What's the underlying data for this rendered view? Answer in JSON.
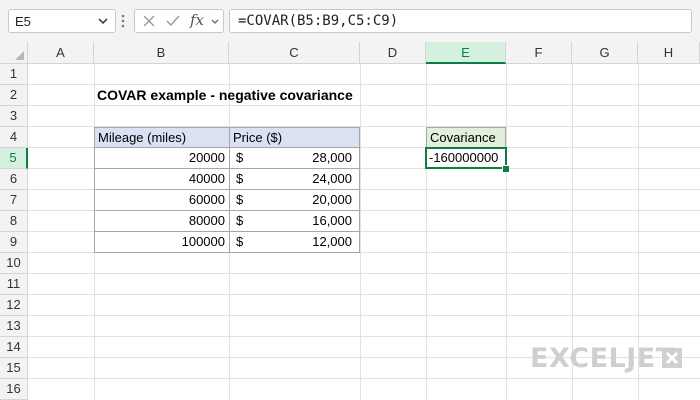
{
  "formula_bar": {
    "name_box": "E5",
    "fx_label": "fx",
    "formula": "=COVAR(B5:B9,C5:C9)"
  },
  "columns": [
    "A",
    "B",
    "C",
    "D",
    "E",
    "F",
    "G",
    "H"
  ],
  "rows": [
    "1",
    "2",
    "3",
    "4",
    "5",
    "6",
    "7",
    "8",
    "9",
    "10",
    "11",
    "12",
    "13",
    "14",
    "15",
    "16"
  ],
  "selected_column": "E",
  "selected_row": "5",
  "sheet": {
    "title": "COVAR example - negative covariance",
    "table": {
      "headers": [
        "Mileage (miles)",
        "Price ($)"
      ],
      "currency_symbol": "$",
      "rows": [
        {
          "mileage": "20000",
          "price": "28,000"
        },
        {
          "mileage": "40000",
          "price": "24,000"
        },
        {
          "mileage": "60000",
          "price": "20,000"
        },
        {
          "mileage": "80000",
          "price": "16,000"
        },
        {
          "mileage": "100000",
          "price": "12,000"
        }
      ]
    },
    "result": {
      "header": "Covariance",
      "value": "-160000000"
    }
  },
  "logo_text": "EXCELJET",
  "colors": {
    "accent": "#107c41",
    "header_fill": "#d9e1f2",
    "result_header_fill": "#e2efda"
  }
}
